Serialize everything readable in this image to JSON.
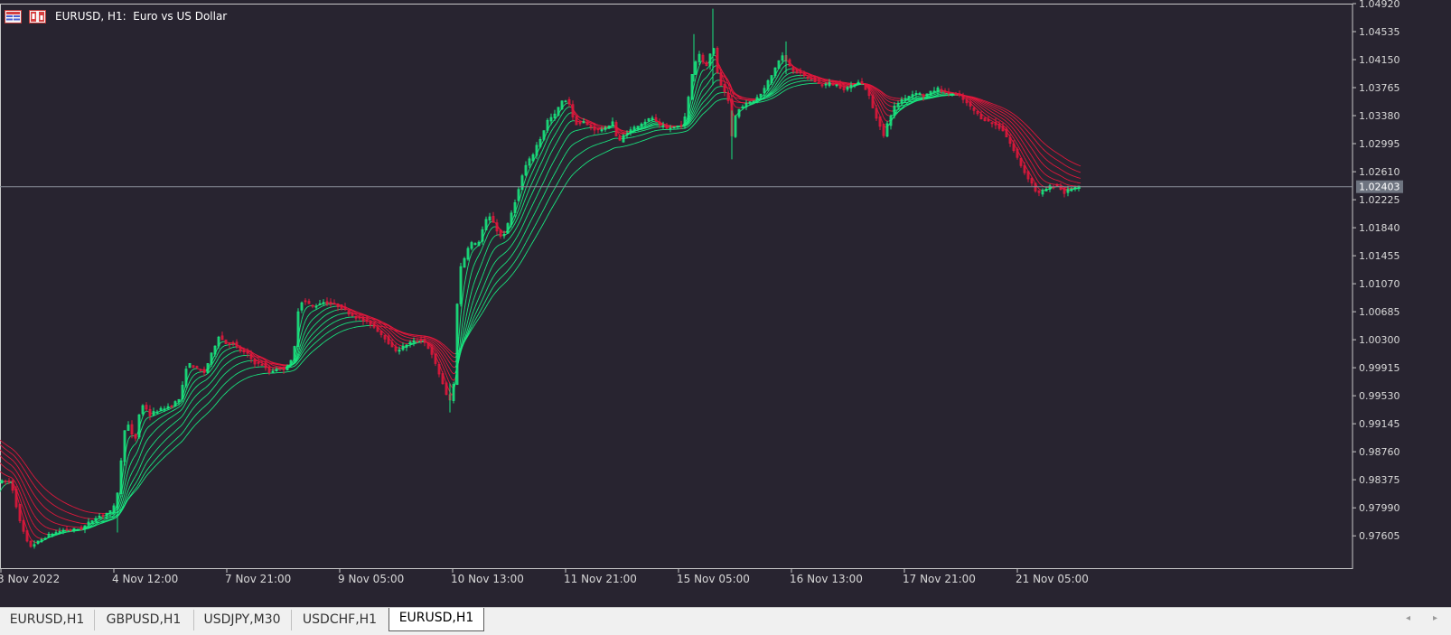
{
  "window": {
    "title": "EURUSD, H1:  Euro vs US Dollar"
  },
  "colors": {
    "background": "#282430",
    "grid_axis": "#c8c8c8",
    "bull": "#19e57f",
    "bear": "#e0183c",
    "price_line": "#8a8e99",
    "price_label_bg": "#6e7480"
  },
  "chart_data": {
    "type": "candlestick",
    "symbol": "EURUSD",
    "timeframe": "H1",
    "description": "Euro vs US Dollar",
    "y_ticks": [
      "1.04920",
      "1.04535",
      "1.04150",
      "1.03765",
      "1.03380",
      "1.02995",
      "1.02610",
      "1.02225",
      "1.01840",
      "1.01455",
      "1.01070",
      "1.00685",
      "1.00300",
      "0.99915",
      "0.99530",
      "0.99145",
      "0.98760",
      "0.98375",
      "0.97990",
      "0.97605"
    ],
    "ylim": [
      0.9716,
      1.0492
    ],
    "x_labels": [
      "3 Nov 2022",
      "4 Nov 12:00",
      "7 Nov 21:00",
      "9 Nov 05:00",
      "10 Nov 13:00",
      "11 Nov 21:00",
      "15 Nov 05:00",
      "16 Nov 13:00",
      "17 Nov 21:00",
      "21 Nov 05:00"
    ],
    "current_price": "1.02403",
    "indicator": {
      "name": "moving average ribbon",
      "ma_count": 8,
      "colors": [
        "#19e57f",
        "#e0183c"
      ]
    },
    "close_path": [
      [
        0,
        0.9835
      ],
      [
        12,
        0.9835
      ],
      [
        22,
        0.978
      ],
      [
        32,
        0.9745
      ],
      [
        42,
        0.9752
      ],
      [
        55,
        0.9762
      ],
      [
        70,
        0.9768
      ],
      [
        90,
        0.977
      ],
      [
        105,
        0.9785
      ],
      [
        115,
        0.979
      ],
      [
        125,
        0.9795
      ],
      [
        130,
        0.982
      ],
      [
        133,
        0.985
      ],
      [
        137,
        0.99
      ],
      [
        140,
        0.992
      ],
      [
        145,
        0.99
      ],
      [
        150,
        0.9895
      ],
      [
        155,
        0.9935
      ],
      [
        160,
        0.9942
      ],
      [
        165,
        0.9925
      ],
      [
        170,
        0.993
      ],
      [
        180,
        0.9935
      ],
      [
        190,
        0.994
      ],
      [
        200,
        0.995
      ],
      [
        205,
        0.999
      ],
      [
        210,
        0.9996
      ],
      [
        218,
        0.999
      ],
      [
        226,
        0.9985
      ],
      [
        234,
        1.001
      ],
      [
        242,
        1.0035
      ],
      [
        250,
        1.0025
      ],
      [
        258,
        1.0025
      ],
      [
        266,
        1.0015
      ],
      [
        274,
        1.001
      ],
      [
        282,
        0.9998
      ],
      [
        290,
        0.9996
      ],
      [
        298,
        0.9985
      ],
      [
        306,
        0.999
      ],
      [
        314,
        0.999
      ],
      [
        322,
        1.0
      ],
      [
        326,
        1.002
      ],
      [
        330,
        1.007
      ],
      [
        335,
        1.0085
      ],
      [
        340,
        1.008
      ],
      [
        348,
        1.0075
      ],
      [
        356,
        1.0082
      ],
      [
        364,
        1.008
      ],
      [
        372,
        1.0078
      ],
      [
        380,
        1.0072
      ],
      [
        388,
        1.0065
      ],
      [
        396,
        1.006
      ],
      [
        404,
        1.0055
      ],
      [
        412,
        1.005
      ],
      [
        420,
        1.004
      ],
      [
        428,
        1.003
      ],
      [
        436,
        1.0015
      ],
      [
        444,
        1.0018
      ],
      [
        452,
        1.0025
      ],
      [
        460,
        1.0028
      ],
      [
        468,
        1.003
      ],
      [
        476,
        1.0015
      ],
      [
        484,
        0.999
      ],
      [
        490,
        0.997
      ],
      [
        495,
        0.995
      ],
      [
        500,
        0.9945
      ],
      [
        503,
        0.998
      ],
      [
        506,
        1.008
      ],
      [
        510,
        1.013
      ],
      [
        515,
        1.0145
      ],
      [
        520,
        1.0165
      ],
      [
        525,
        1.016
      ],
      [
        530,
        1.0165
      ],
      [
        535,
        1.0185
      ],
      [
        540,
        1.02
      ],
      [
        545,
        1.0195
      ],
      [
        550,
        1.018
      ],
      [
        555,
        1.017
      ],
      [
        560,
        1.018
      ],
      [
        565,
        1.02
      ],
      [
        570,
        1.022
      ],
      [
        575,
        1.024
      ],
      [
        580,
        1.0265
      ],
      [
        585,
        1.0275
      ],
      [
        590,
        1.0285
      ],
      [
        595,
        1.03
      ],
      [
        600,
        1.031
      ],
      [
        605,
        1.033
      ],
      [
        610,
        1.0335
      ],
      [
        615,
        1.034
      ],
      [
        620,
        1.0355
      ],
      [
        625,
        1.036
      ],
      [
        630,
        1.0355
      ],
      [
        635,
        1.033
      ],
      [
        640,
        1.0325
      ],
      [
        645,
        1.033
      ],
      [
        650,
        1.0325
      ],
      [
        660,
        1.0318
      ],
      [
        670,
        1.032
      ],
      [
        678,
        1.033
      ],
      [
        684,
        1.03
      ],
      [
        690,
        1.031
      ],
      [
        698,
        1.0318
      ],
      [
        706,
        1.0325
      ],
      [
        714,
        1.033
      ],
      [
        722,
        1.0335
      ],
      [
        730,
        1.0325
      ],
      [
        738,
        1.032
      ],
      [
        746,
        1.0322
      ],
      [
        754,
        1.0325
      ],
      [
        760,
        1.034
      ],
      [
        764,
        1.0385
      ],
      [
        768,
        1.0405
      ],
      [
        772,
        1.042
      ],
      [
        776,
        1.0425
      ],
      [
        780,
        1.04
      ],
      [
        785,
        1.042
      ],
      [
        790,
        1.043
      ],
      [
        795,
        1.039
      ],
      [
        800,
        1.0375
      ],
      [
        806,
        1.036
      ],
      [
        810,
        1.031
      ],
      [
        815,
        1.0345
      ],
      [
        820,
        1.035
      ],
      [
        828,
        1.0355
      ],
      [
        836,
        1.036
      ],
      [
        844,
        1.037
      ],
      [
        850,
        1.0385
      ],
      [
        855,
        1.0395
      ],
      [
        860,
        1.041
      ],
      [
        866,
        1.042
      ],
      [
        872,
        1.041
      ],
      [
        878,
        1.04
      ],
      [
        886,
        1.0395
      ],
      [
        894,
        1.039
      ],
      [
        902,
        1.0385
      ],
      [
        910,
        1.038
      ],
      [
        918,
        1.0382
      ],
      [
        926,
        1.038
      ],
      [
        934,
        1.0375
      ],
      [
        942,
        1.0378
      ],
      [
        950,
        1.0385
      ],
      [
        956,
        1.038
      ],
      [
        962,
        1.0365
      ],
      [
        968,
        1.034
      ],
      [
        974,
        1.0325
      ],
      [
        978,
        1.031
      ],
      [
        983,
        1.033
      ],
      [
        990,
        1.035
      ],
      [
        998,
        1.036
      ],
      [
        1006,
        1.0365
      ],
      [
        1014,
        1.037
      ],
      [
        1022,
        1.0365
      ],
      [
        1030,
        1.037
      ],
      [
        1038,
        1.0375
      ],
      [
        1046,
        1.037
      ],
      [
        1054,
        1.0368
      ],
      [
        1062,
        1.0365
      ],
      [
        1070,
        1.0355
      ],
      [
        1078,
        1.0345
      ],
      [
        1086,
        1.0335
      ],
      [
        1094,
        1.033
      ],
      [
        1102,
        1.0325
      ],
      [
        1110,
        1.0318
      ],
      [
        1118,
        1.03
      ],
      [
        1126,
        1.028
      ],
      [
        1134,
        1.026
      ],
      [
        1142,
        1.0245
      ],
      [
        1148,
        1.023
      ],
      [
        1155,
        1.0235
      ],
      [
        1162,
        1.024
      ],
      [
        1170,
        1.0242
      ],
      [
        1178,
        1.0232
      ],
      [
        1186,
        1.0238
      ],
      [
        1197,
        1.024
      ]
    ]
  },
  "tabs": [
    {
      "label": "EURUSD,H1"
    },
    {
      "label": "GBPUSD,H1"
    },
    {
      "label": "USDJPY,M30"
    },
    {
      "label": "USDCHF,H1"
    },
    {
      "label": "EURUSD,H1"
    }
  ],
  "tab_scroll": {
    "left": "◂",
    "right": "▸"
  }
}
